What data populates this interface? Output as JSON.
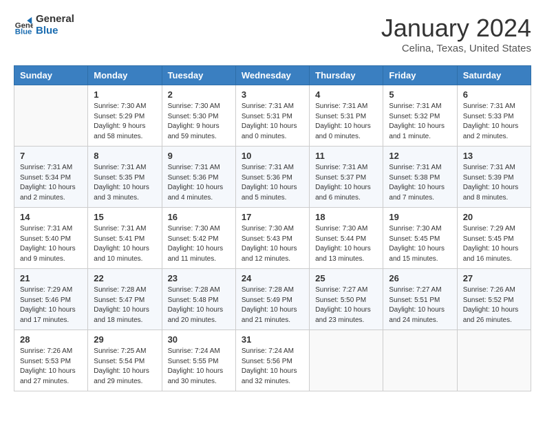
{
  "header": {
    "logo_line1": "General",
    "logo_line2": "Blue",
    "month_title": "January 2024",
    "location": "Celina, Texas, United States"
  },
  "weekdays": [
    "Sunday",
    "Monday",
    "Tuesday",
    "Wednesday",
    "Thursday",
    "Friday",
    "Saturday"
  ],
  "weeks": [
    [
      {
        "day": "",
        "info": ""
      },
      {
        "day": "1",
        "info": "Sunrise: 7:30 AM\nSunset: 5:29 PM\nDaylight: 9 hours\nand 58 minutes."
      },
      {
        "day": "2",
        "info": "Sunrise: 7:30 AM\nSunset: 5:30 PM\nDaylight: 9 hours\nand 59 minutes."
      },
      {
        "day": "3",
        "info": "Sunrise: 7:31 AM\nSunset: 5:31 PM\nDaylight: 10 hours\nand 0 minutes."
      },
      {
        "day": "4",
        "info": "Sunrise: 7:31 AM\nSunset: 5:31 PM\nDaylight: 10 hours\nand 0 minutes."
      },
      {
        "day": "5",
        "info": "Sunrise: 7:31 AM\nSunset: 5:32 PM\nDaylight: 10 hours\nand 1 minute."
      },
      {
        "day": "6",
        "info": "Sunrise: 7:31 AM\nSunset: 5:33 PM\nDaylight: 10 hours\nand 2 minutes."
      }
    ],
    [
      {
        "day": "7",
        "info": "Sunrise: 7:31 AM\nSunset: 5:34 PM\nDaylight: 10 hours\nand 2 minutes."
      },
      {
        "day": "8",
        "info": "Sunrise: 7:31 AM\nSunset: 5:35 PM\nDaylight: 10 hours\nand 3 minutes."
      },
      {
        "day": "9",
        "info": "Sunrise: 7:31 AM\nSunset: 5:36 PM\nDaylight: 10 hours\nand 4 minutes."
      },
      {
        "day": "10",
        "info": "Sunrise: 7:31 AM\nSunset: 5:36 PM\nDaylight: 10 hours\nand 5 minutes."
      },
      {
        "day": "11",
        "info": "Sunrise: 7:31 AM\nSunset: 5:37 PM\nDaylight: 10 hours\nand 6 minutes."
      },
      {
        "day": "12",
        "info": "Sunrise: 7:31 AM\nSunset: 5:38 PM\nDaylight: 10 hours\nand 7 minutes."
      },
      {
        "day": "13",
        "info": "Sunrise: 7:31 AM\nSunset: 5:39 PM\nDaylight: 10 hours\nand 8 minutes."
      }
    ],
    [
      {
        "day": "14",
        "info": "Sunrise: 7:31 AM\nSunset: 5:40 PM\nDaylight: 10 hours\nand 9 minutes."
      },
      {
        "day": "15",
        "info": "Sunrise: 7:31 AM\nSunset: 5:41 PM\nDaylight: 10 hours\nand 10 minutes."
      },
      {
        "day": "16",
        "info": "Sunrise: 7:30 AM\nSunset: 5:42 PM\nDaylight: 10 hours\nand 11 minutes."
      },
      {
        "day": "17",
        "info": "Sunrise: 7:30 AM\nSunset: 5:43 PM\nDaylight: 10 hours\nand 12 minutes."
      },
      {
        "day": "18",
        "info": "Sunrise: 7:30 AM\nSunset: 5:44 PM\nDaylight: 10 hours\nand 13 minutes."
      },
      {
        "day": "19",
        "info": "Sunrise: 7:30 AM\nSunset: 5:45 PM\nDaylight: 10 hours\nand 15 minutes."
      },
      {
        "day": "20",
        "info": "Sunrise: 7:29 AM\nSunset: 5:45 PM\nDaylight: 10 hours\nand 16 minutes."
      }
    ],
    [
      {
        "day": "21",
        "info": "Sunrise: 7:29 AM\nSunset: 5:46 PM\nDaylight: 10 hours\nand 17 minutes."
      },
      {
        "day": "22",
        "info": "Sunrise: 7:28 AM\nSunset: 5:47 PM\nDaylight: 10 hours\nand 18 minutes."
      },
      {
        "day": "23",
        "info": "Sunrise: 7:28 AM\nSunset: 5:48 PM\nDaylight: 10 hours\nand 20 minutes."
      },
      {
        "day": "24",
        "info": "Sunrise: 7:28 AM\nSunset: 5:49 PM\nDaylight: 10 hours\nand 21 minutes."
      },
      {
        "day": "25",
        "info": "Sunrise: 7:27 AM\nSunset: 5:50 PM\nDaylight: 10 hours\nand 23 minutes."
      },
      {
        "day": "26",
        "info": "Sunrise: 7:27 AM\nSunset: 5:51 PM\nDaylight: 10 hours\nand 24 minutes."
      },
      {
        "day": "27",
        "info": "Sunrise: 7:26 AM\nSunset: 5:52 PM\nDaylight: 10 hours\nand 26 minutes."
      }
    ],
    [
      {
        "day": "28",
        "info": "Sunrise: 7:26 AM\nSunset: 5:53 PM\nDaylight: 10 hours\nand 27 minutes."
      },
      {
        "day": "29",
        "info": "Sunrise: 7:25 AM\nSunset: 5:54 PM\nDaylight: 10 hours\nand 29 minutes."
      },
      {
        "day": "30",
        "info": "Sunrise: 7:24 AM\nSunset: 5:55 PM\nDaylight: 10 hours\nand 30 minutes."
      },
      {
        "day": "31",
        "info": "Sunrise: 7:24 AM\nSunset: 5:56 PM\nDaylight: 10 hours\nand 32 minutes."
      },
      {
        "day": "",
        "info": ""
      },
      {
        "day": "",
        "info": ""
      },
      {
        "day": "",
        "info": ""
      }
    ]
  ]
}
